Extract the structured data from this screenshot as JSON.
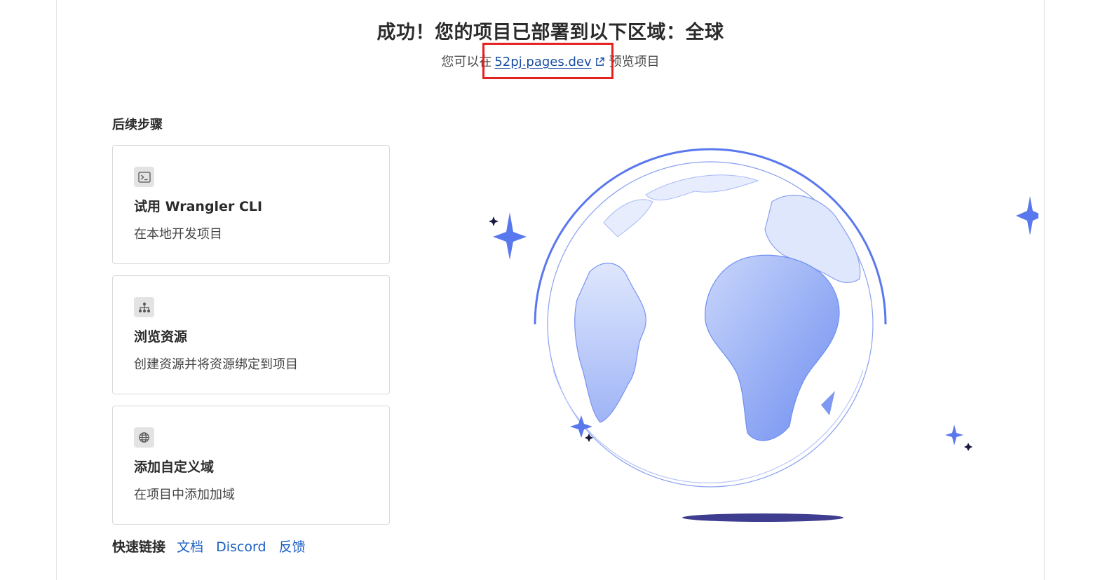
{
  "header": {
    "title": "成功！您的项目已部署到以下区域：全球",
    "subtitle_prefix": "您可以在",
    "url": "52pj.pages.dev",
    "subtitle_suffix": "预览项目"
  },
  "next_steps": {
    "heading": "后续步骤",
    "cards": [
      {
        "icon": "terminal-icon",
        "title": "试用 Wrangler CLI",
        "description": "在本地开发项目"
      },
      {
        "icon": "sitemap-icon",
        "title": "浏览资源",
        "description": "创建资源并将资源绑定到项目"
      },
      {
        "icon": "globe-icon",
        "title": "添加自定义域",
        "description": "在项目中添加加域"
      }
    ]
  },
  "quick_links": {
    "label": "快速链接",
    "links": [
      "文档",
      "Discord",
      "反馈"
    ]
  },
  "illustration": {
    "icon": "globe-illustration",
    "accent": "#5a78ee",
    "shadow": "#3f3d8f"
  },
  "colors": {
    "highlight": "#e52220",
    "link": "#1b4ea3"
  }
}
